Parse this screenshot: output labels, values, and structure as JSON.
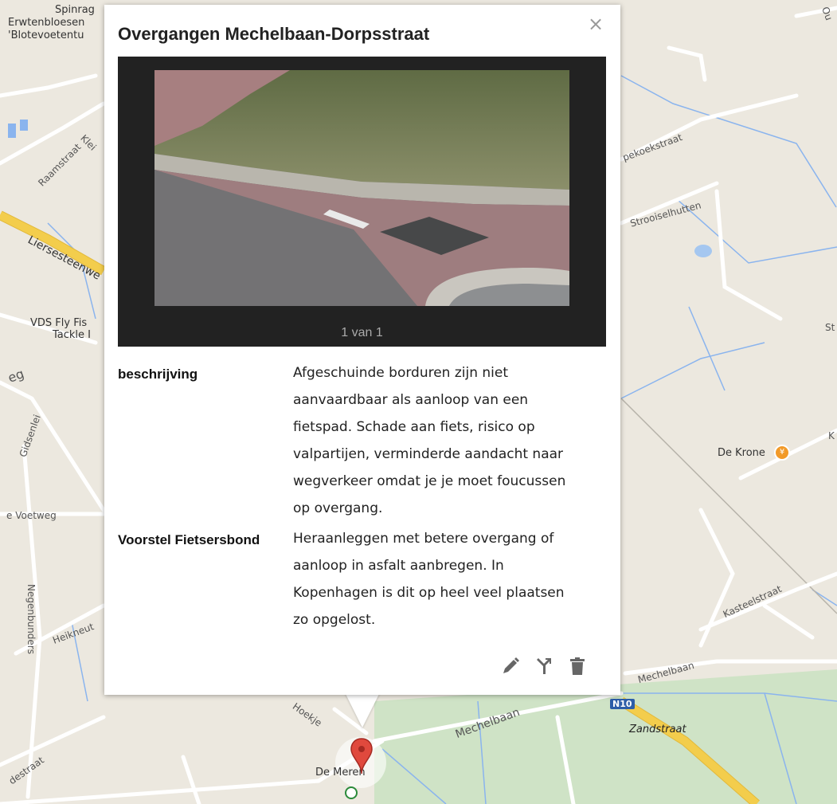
{
  "map": {
    "labels": {
      "spinrag": "Spinrag",
      "erwtenbloesem": "Erwtenbloesen",
      "blotevoetentuin": "'Blotevoetentu",
      "raamstraat": "Raamstraat",
      "klein": "Klei",
      "liersesteenweg": "Liersesteenwe",
      "vds_fly": "VDS Fly Fis",
      "tackle": "Tackle I",
      "weg": "eg",
      "gidsenlei": "Gidsenlei",
      "voetweg": "e Voetweg",
      "negenbunders": "Negenbunders",
      "heikneuter": "Heikneut",
      "destraat": "destraat",
      "hoekje": "Hoekje",
      "mechelbaan_bottom": "Mechelbaan",
      "mechelbaan_right": "Mechelbaan",
      "de_meren": "De Meren",
      "zandstraat": "Zandstraat",
      "n10": "N10",
      "koekstraat": "pekoekstraat",
      "strooiselhutten": "Strooiselhutten",
      "de_krone": "De Krone",
      "kasteelstraat": "Kasteelstraat",
      "st": "St",
      "k": "K",
      "o": "Ou"
    },
    "colors": {
      "background": "#ece8df",
      "road": "#ffffff",
      "highway": "#f3cd4c",
      "water": "#a5c7f0",
      "park": "#cfe3c6",
      "marker": "#e0493d"
    }
  },
  "popup": {
    "title": "Overgangen Mechelbaan-Dorpsstraat",
    "close_icon": "×",
    "photo_counter": "1 van 1",
    "properties": [
      {
        "key": "beschrijving",
        "value_lines": [
          "Afgeschuinde borduren zijn niet",
          "aanvaardbaar als aanloop van een",
          "fietspad. Schade aan fiets, risico op",
          "valpartijen, verminderde aandacht naar",
          "wegverkeer omdat je je moet foucussen",
          "op  overgang."
        ]
      },
      {
        "key": "Voorstel Fietsersbond",
        "value_lines": [
          "Heraanleggen met betere overgang of",
          "aanloop in asfalt aanbregen. In",
          "Kopenhagen is dit op heel veel plaatsen",
          "zo opgelost."
        ]
      }
    ],
    "tools": [
      "pencil-icon",
      "branch-icon",
      "trash-icon"
    ]
  }
}
